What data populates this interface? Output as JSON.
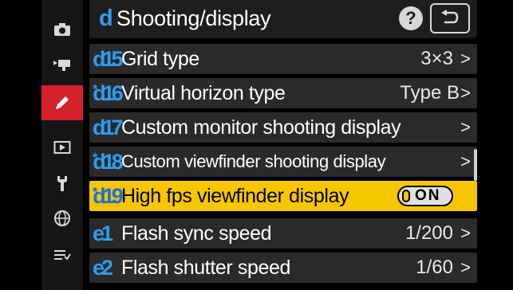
{
  "header": {
    "menu_letter": "d",
    "title": "Shooting/display",
    "help_label": "?"
  },
  "sidebar": {
    "tabs": [
      {
        "icon": "camera-icon"
      },
      {
        "icon": "movie-camera-icon"
      },
      {
        "icon": "pencil-icon",
        "active": true
      },
      {
        "icon": "playback-icon"
      },
      {
        "icon": "wrench-icon"
      },
      {
        "icon": "network-icon"
      },
      {
        "icon": "my-menu-icon"
      }
    ]
  },
  "menu": {
    "items": [
      {
        "code_prefix": "d",
        "code_num": "15",
        "label": "Grid type",
        "value": "3×3",
        "chevron": ">"
      },
      {
        "code_prefix": "d",
        "code_num": "16",
        "starred": true,
        "label": "Virtual horizon type",
        "value": "Type  B",
        "chevron": ">"
      },
      {
        "code_prefix": "d",
        "code_num": "17",
        "label": "Custom monitor shooting display",
        "value": "",
        "chevron": ">"
      },
      {
        "code_prefix": "d",
        "code_num": "18",
        "starred": true,
        "label": "Custom viewfinder shooting display",
        "value": "",
        "chevron": ">"
      },
      {
        "code_prefix": "d",
        "code_num": "19",
        "starred": true,
        "label": "High fps viewfinder display",
        "toggle": "ON",
        "selected": true
      },
      {
        "code_prefix": "e",
        "code_num": "1",
        "label": "Flash sync speed",
        "value": "1/200",
        "chevron": ">"
      },
      {
        "code_prefix": "e",
        "code_num": "2",
        "label": "Flash shutter speed",
        "value": "1/60",
        "chevron": ">"
      }
    ]
  },
  "colors": {
    "accent_blue": "#2e9cf0",
    "selected_yellow": "#f6c600",
    "active_tab_red": "#d6202a"
  }
}
